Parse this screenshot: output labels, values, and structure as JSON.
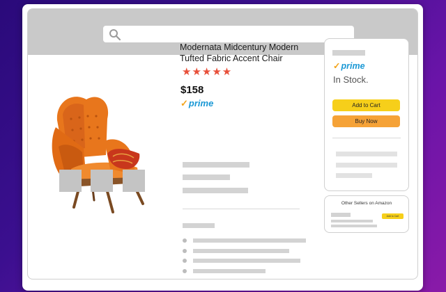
{
  "search": {
    "placeholder": ""
  },
  "product": {
    "title": "Modernata Midcentury Modern Tufted Fabric Accent Chair",
    "rating_stars": "★★★★★",
    "price": "$158",
    "prime_check": "✓",
    "prime_label": "prime"
  },
  "buybox": {
    "prime_check": "✓",
    "prime_label": "prime",
    "stock_status": "In Stock.",
    "add_to_cart_label": "Add to Cart",
    "buy_now_label": "Buy Now"
  },
  "other_sellers": {
    "title": "Other Sellers on Amazon",
    "add_to_cart_label": "Add to Cart"
  },
  "colors": {
    "header_bg": "#c9c9c9",
    "star_color": "#e8503a",
    "prime_blue": "#1a98d5",
    "prime_check": "#f3a41b",
    "add_to_cart_btn": "#f6cf1a",
    "buy_now_btn": "#f5a237",
    "chair_orange": "#e8761c"
  },
  "icons": {
    "search": "search-icon",
    "product_image": "armchair-image"
  }
}
